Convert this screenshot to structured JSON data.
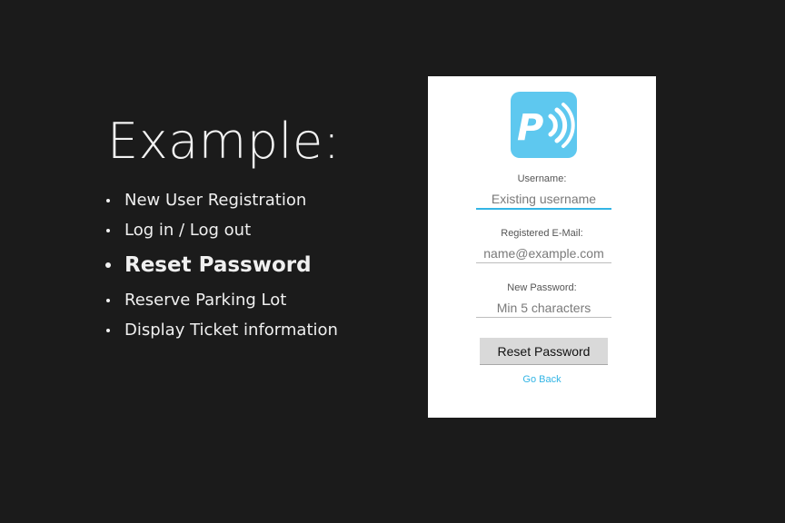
{
  "slide": {
    "title": "Example:",
    "bullets": [
      {
        "label": "New User Registration"
      },
      {
        "label": "Log in / Log out"
      },
      {
        "label": "Reset Password"
      },
      {
        "label": "Reserve Parking Lot"
      },
      {
        "label": "Display Ticket information"
      }
    ],
    "active_bullet_index": 2
  },
  "app": {
    "logo_icon": "parking-wireless-icon",
    "logo_letter": "P",
    "logo_color": "#5ec8ef",
    "accent_color": "#33b5e5",
    "fields": {
      "username": {
        "label": "Username:",
        "placeholder": "Existing username"
      },
      "email": {
        "label": "Registered E-Mail:",
        "placeholder": "name@example.com"
      },
      "new_password": {
        "label": "New Password:",
        "placeholder": "Min 5 characters"
      }
    },
    "reset_button_label": "Reset Password",
    "go_back_label": "Go Back"
  }
}
